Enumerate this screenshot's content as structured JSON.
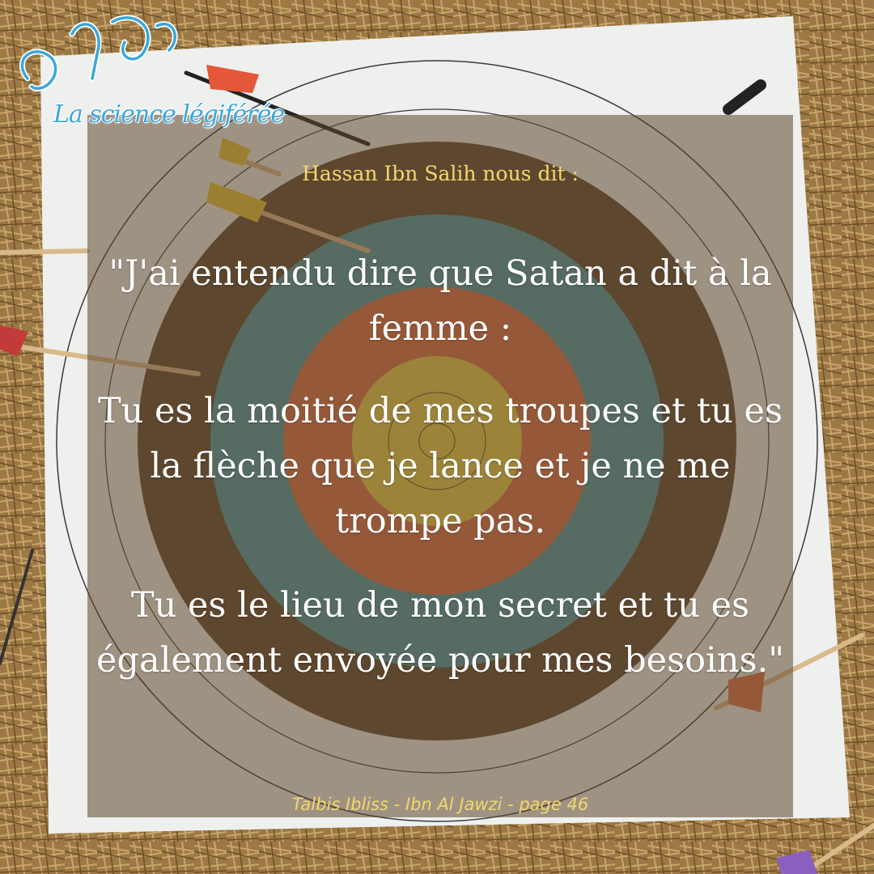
{
  "brand": {
    "arabic_logo": "العلم الشرعي",
    "script_name": "La science légiférée"
  },
  "intro": "Hassan Ibn Salih nous dit :",
  "quote": {
    "p1": "\"J'ai entendu dire que Satan a dit à la femme :",
    "p2": "Tu es la moitié de mes troupes et tu es la flèche que je lance et je ne me trompe pas.",
    "p3": "Tu es le lieu de mon secret et tu es également envoyée pour mes besoins.\""
  },
  "source": "Talbis Ibliss - Ibn Al Jawzi - page 46",
  "colors": {
    "accent_yellow": "#f3d86b",
    "quote_text": "#ffffff",
    "logo_blue": "#3aa7dc",
    "straw": "#b08a4e",
    "ring_brown": "#5f4a33",
    "ring_teal": "#4e9aa3",
    "ring_orange": "#d9714a",
    "ring_yellow": "#e6cf4a"
  },
  "icons": [
    "archery-target",
    "arrow",
    "logo"
  ]
}
